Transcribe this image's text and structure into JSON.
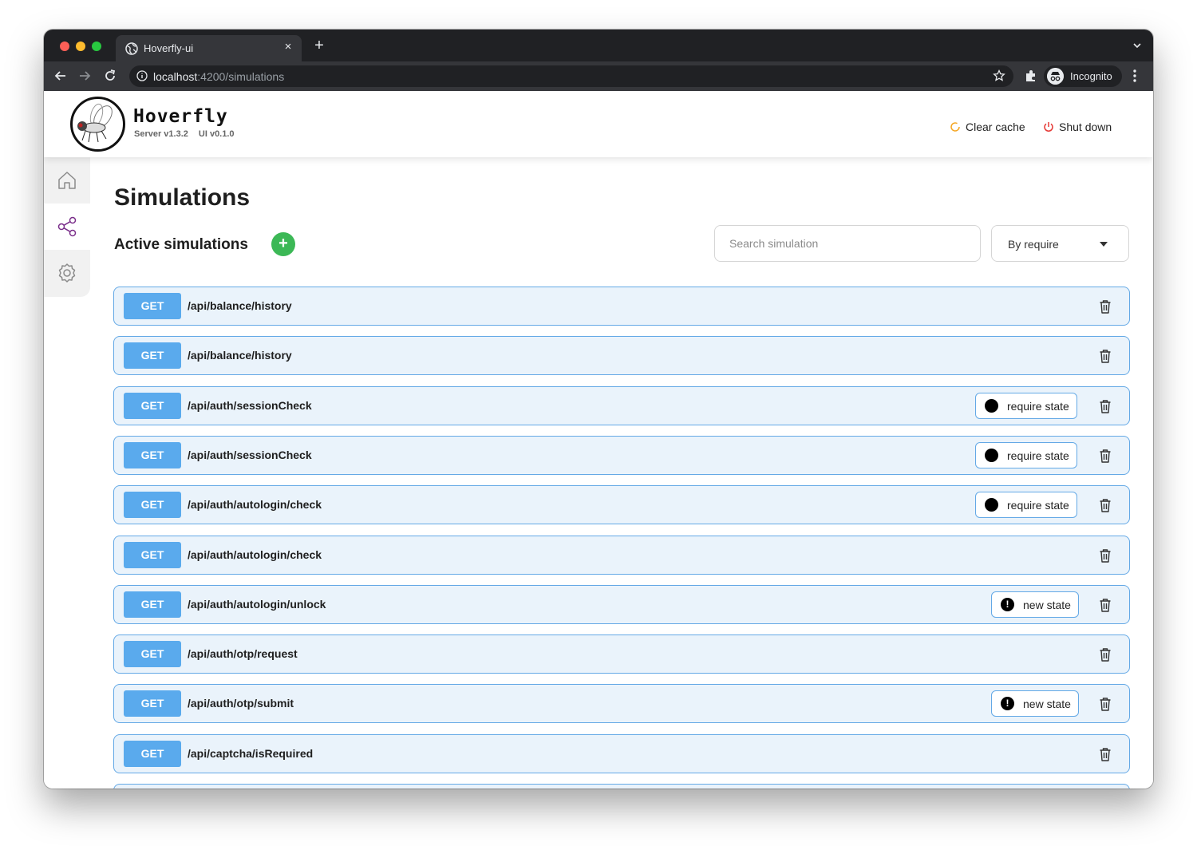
{
  "browser": {
    "tab_title": "Hoverfly-ui",
    "tab_close": "×",
    "new_tab": "+",
    "url_host": "localhost",
    "url_path": ":4200/simulations",
    "profile_label": "Incognito"
  },
  "header": {
    "brand": "Hoverfly",
    "server_version": "Server v1.3.2",
    "ui_version": "UI v0.1.0",
    "clear_cache_label": "Clear cache",
    "shut_down_label": "Shut down"
  },
  "sidebar": {
    "items": [
      {
        "icon": "home-icon",
        "active": false
      },
      {
        "icon": "share-icon",
        "active": true
      },
      {
        "icon": "gear-icon",
        "active": false
      }
    ]
  },
  "page": {
    "title": "Simulations",
    "section_title": "Active simulations",
    "add_label": "+",
    "search_placeholder": "Search simulation",
    "sort_value": "By require"
  },
  "simulations": [
    {
      "method": "GET",
      "path": "/api/balance/history",
      "state": null
    },
    {
      "method": "GET",
      "path": "/api/balance/history",
      "state": null
    },
    {
      "method": "GET",
      "path": "/api/auth/sessionCheck",
      "state": {
        "label": "require state",
        "kind": "require"
      }
    },
    {
      "method": "GET",
      "path": "/api/auth/sessionCheck",
      "state": {
        "label": "require state",
        "kind": "require"
      }
    },
    {
      "method": "GET",
      "path": "/api/auth/autologin/check",
      "state": {
        "label": "require state",
        "kind": "require"
      }
    },
    {
      "method": "GET",
      "path": "/api/auth/autologin/check",
      "state": null
    },
    {
      "method": "GET",
      "path": "/api/auth/autologin/unlock",
      "state": {
        "label": "new state",
        "kind": "new"
      }
    },
    {
      "method": "GET",
      "path": "/api/auth/otp/request",
      "state": null
    },
    {
      "method": "GET",
      "path": "/api/auth/otp/submit",
      "state": {
        "label": "new state",
        "kind": "new"
      }
    },
    {
      "method": "GET",
      "path": "/api/captcha/isRequired",
      "state": null
    }
  ],
  "colors": {
    "accent_green": "#3cb856",
    "method_blue": "#5aaaed",
    "row_border": "#64a9e6",
    "row_bg": "#eaf3fb",
    "clear_cache_icon": "#f5a623",
    "shut_down_icon": "#e53935",
    "active_nav": "#7a2e8a"
  }
}
